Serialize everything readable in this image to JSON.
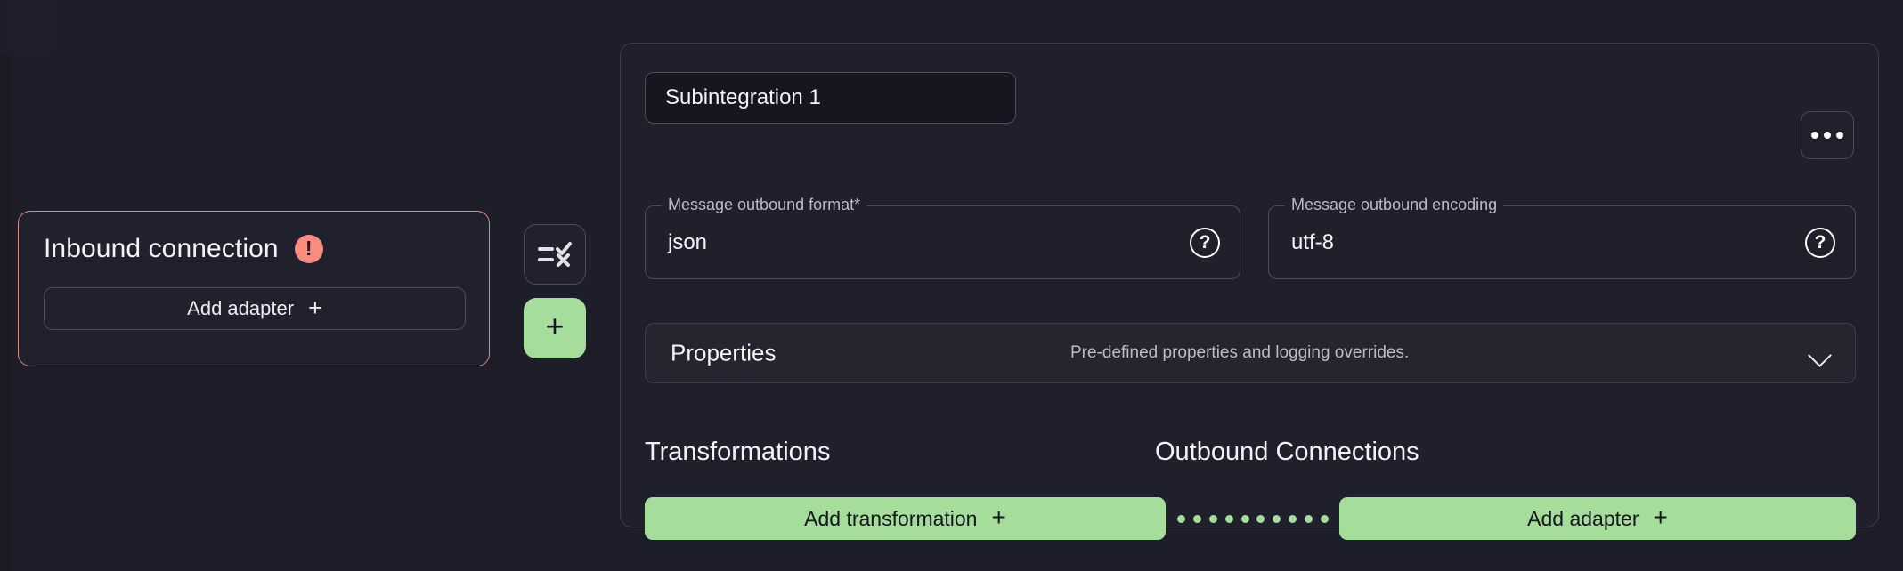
{
  "theme": {
    "page_background": "#1d1e29",
    "panel_background": "#1f202c",
    "accent_green": "#a5dd9b",
    "error_color": "#f98c80",
    "border_color": "#4a4d5e",
    "text_primary": "#f2f3f7",
    "text_secondary": "#b8bcc9"
  },
  "inbound_card": {
    "title": "Inbound connection",
    "status_icon": "error-exclamation-icon",
    "add_adapter_label": "Add adapter",
    "add_adapter_icon": "plus-icon"
  },
  "middle_actions": {
    "validate_icon": "checklist-validate-icon",
    "add_subintegration_icon": "plus-icon"
  },
  "panel": {
    "title_value": "Subintegration 1",
    "title_placeholder": "Subintegration name",
    "menu_icon": "kebab-menu-icon",
    "fields": [
      {
        "legend": "Message outbound format*",
        "value": "json",
        "help_icon": "help-circle-icon"
      },
      {
        "legend": "Message outbound encoding",
        "value": "utf-8",
        "help_icon": "help-circle-icon"
      }
    ],
    "properties": {
      "title": "Properties",
      "description": "Pre-defined properties and logging overrides.",
      "chevron_icon": "chevron-down-icon"
    },
    "sections": {
      "transformations_heading": "Transformations",
      "add_transformation_label": "Add transformation",
      "add_transformation_icon": "plus-icon",
      "outbound_heading": "Outbound Connections",
      "add_adapter_label": "Add adapter",
      "add_adapter_icon": "plus-icon",
      "connector_dots": 10
    }
  }
}
